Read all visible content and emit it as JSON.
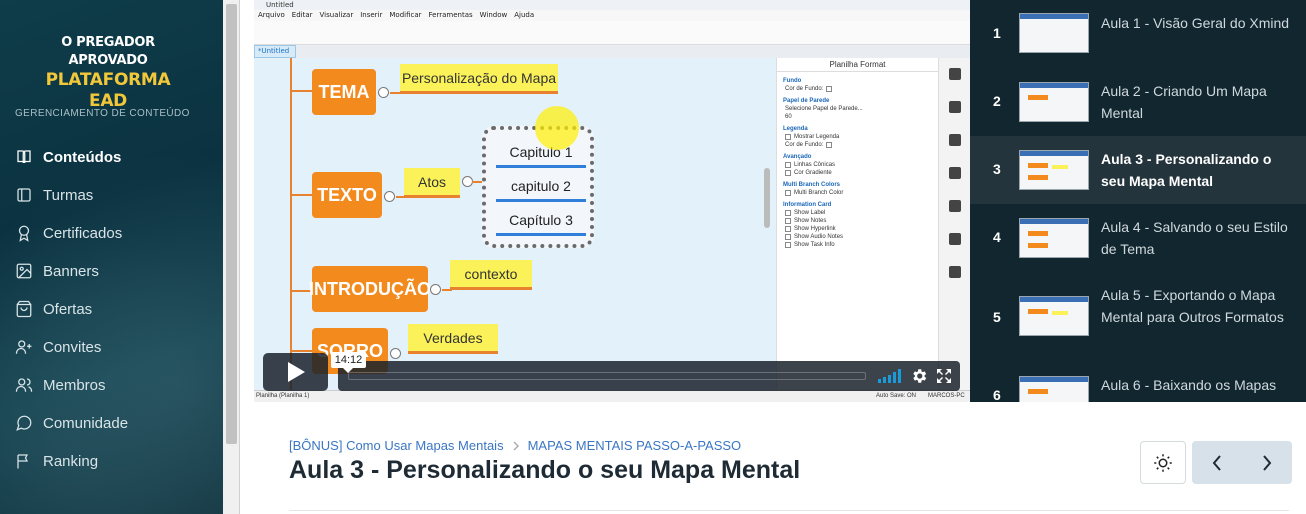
{
  "brand": {
    "line1": "O PREGADOR APROVADO",
    "line2": "PLATAFORMA EAD"
  },
  "sidebar": {
    "section_title": "GERENCIAMENTO DE CONTEÚDO",
    "items": [
      {
        "label": "Conteúdos",
        "icon": "book-icon",
        "active": true
      },
      {
        "label": "Turmas",
        "icon": "folder-icon"
      },
      {
        "label": "Certificados",
        "icon": "award-icon"
      },
      {
        "label": "Banners",
        "icon": "image-icon"
      },
      {
        "label": "Ofertas",
        "icon": "shopping-bag-icon"
      },
      {
        "label": "Convites",
        "icon": "user-plus-icon"
      },
      {
        "label": "Membros",
        "icon": "users-icon"
      },
      {
        "label": "Comunidade",
        "icon": "chat-icon"
      },
      {
        "label": "Ranking",
        "icon": "flag-icon"
      }
    ]
  },
  "video": {
    "app_title": "Untitled",
    "menu": [
      "Arquivo",
      "Editar",
      "Visualizar",
      "Inserir",
      "Modificar",
      "Ferramentas",
      "Window",
      "Ajuda"
    ],
    "tab": "*Untitled",
    "topics": [
      {
        "label": "TEMA",
        "sub": "Personalização do Mapa"
      },
      {
        "label": "TEXTO",
        "sub": "Atos"
      },
      {
        "label": "INTRODUÇÃO",
        "sub": "contexto"
      },
      {
        "label": "SORRO",
        "sub": "Verdades"
      }
    ],
    "chapters": [
      "Capitulo 1",
      "capitulo 2",
      "Capítulo 3"
    ],
    "panel": {
      "title": "Planilha Format",
      "fundo": "Fundo",
      "cor_fundo": "Cor de Fundo:",
      "papel": "Papel de Parede",
      "selecione": "Selecione Papel de Parede...",
      "opacity": "60",
      "legenda": "Legenda",
      "mostrar_legenda": "Mostrar Legenda",
      "avancado": "Avançado",
      "linhas_conicas": "Linhas Cônicas",
      "cor_gradiente": "Cor Gradiente",
      "multi_branch": "Multi Branch Colors",
      "multi_branch_color": "Multi Branch Color",
      "info_card": "Information Card",
      "show_label": "Show Label",
      "show_notes": "Show Notes",
      "show_hyperlink": "Show Hyperlink",
      "show_audio": "Show Audio Notes",
      "show_task": "Show Task Info"
    },
    "status_left": "Planilha (Planilha 1)",
    "status_right": "Auto Save: ON",
    "status_user": "MARCOS-PC",
    "time": "14:12"
  },
  "playlist": [
    {
      "num": "1",
      "title": "Aula 1 - Visão Geral do Xmind"
    },
    {
      "num": "2",
      "title": "Aula 2 - Criando Um Mapa Mental"
    },
    {
      "num": "3",
      "title": "Aula 3 - Personalizando o seu Mapa Mental",
      "active": true
    },
    {
      "num": "4",
      "title": "Aula 4 - Salvando o seu Estilo de Tema"
    },
    {
      "num": "5",
      "title": "Aula 5 - Exportando o Mapa Mental para Outros Formatos"
    },
    {
      "num": "6",
      "title": "Aula 6 - Baixando os Mapas Mentais da Plataforma"
    }
  ],
  "breadcrumb": {
    "course": "[BÔNUS] Como Usar Mapas Mentais",
    "module": "MAPAS MENTAIS PASSO-A-PASSO"
  },
  "lesson_title": "Aula 3 - Personalizando o seu Mapa Mental"
}
